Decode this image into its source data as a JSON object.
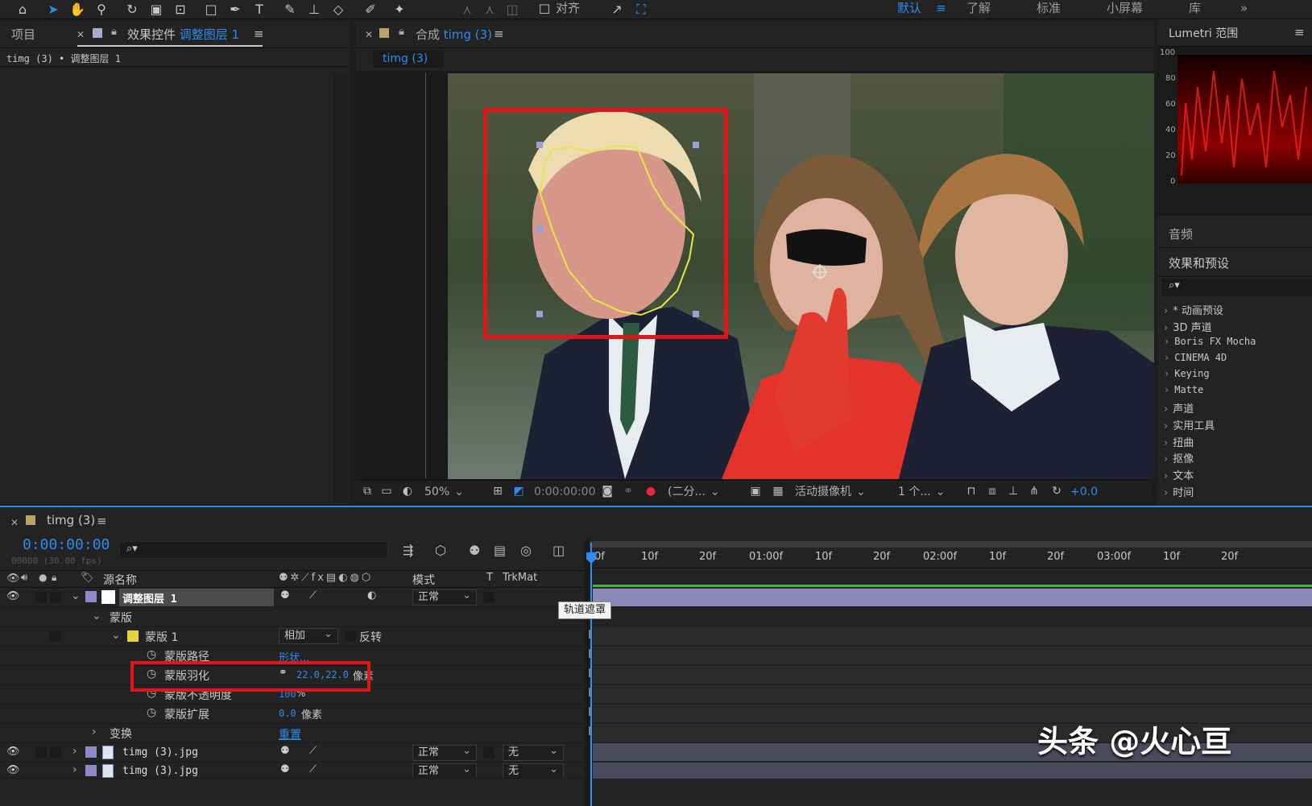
{
  "toolbar": {
    "align_label": "对齐",
    "workspaces": [
      "默认",
      "了解",
      "标准",
      "小屏幕",
      "库"
    ],
    "more": "»"
  },
  "project_panel": {
    "tab_project": "项目",
    "tab_effect_controls_prefix": "效果控件",
    "tab_effect_controls_layer": "调整图层 1",
    "breadcrumb": "timg (3) • 调整图层 1"
  },
  "comp_panel": {
    "tab_label_prefix": "合成",
    "tab_label_name": "timg (3)",
    "sub_tab": "timg (3)"
  },
  "viewer_bar": {
    "zoom": "50%",
    "timecode": "0:00:00:00",
    "resolution": "(二分...",
    "camera": "活动摄像机",
    "views": "1 个...",
    "exposure": "+0.0"
  },
  "lumetri": {
    "title": "Lumetri 范围",
    "scale": [
      "100",
      "80",
      "60",
      "40",
      "20",
      "0"
    ]
  },
  "right_panel": {
    "audio": "音频",
    "effects_title": "效果和预设",
    "search_icon": "⌕▾",
    "items": [
      "* 动画预设",
      "3D 声道",
      "Boris FX Mocha",
      "CINEMA 4D",
      "Keying",
      "Matte",
      "声道",
      "实用工具",
      "扭曲",
      "抠像",
      "文本",
      "时间"
    ]
  },
  "timeline": {
    "tab_name": "timg (3)",
    "timecode": "0:00:00:00",
    "frames": "00000 (30.00 fps)",
    "search_placeholder": "⌕▾",
    "header": {
      "source_name": "源名称",
      "mode": "模式",
      "t": "T",
      "trkmat": "TrkMat"
    },
    "tooltip": "轨道遮罩",
    "ruler": [
      "0f",
      "10f",
      "20f",
      "01:00f",
      "10f",
      "20f",
      "02:00f",
      "10f",
      "20f",
      "03:00f",
      "10f",
      "20f"
    ],
    "layers": {
      "layer1_name": "调整图层 1",
      "layer1_mode": "正常",
      "mask_group": "蒙版",
      "mask1_name": "蒙版 1",
      "mask1_mode": "相加",
      "mask1_invert": "反转",
      "mask_path_label": "蒙版路径",
      "mask_path_value": "形状...",
      "mask_feather_label": "蒙版羽化",
      "mask_feather_value": "22.0,22.0",
      "mask_feather_unit": "像素",
      "mask_opacity_label": "蒙版不透明度",
      "mask_opacity_value": "100",
      "mask_opacity_unit": "%",
      "mask_expansion_label": "蒙版扩展",
      "mask_expansion_value": "0.0",
      "mask_expansion_unit": "像素",
      "transform_label": "变换",
      "transform_value": "重置",
      "layer2_name": "timg (3).jpg",
      "layer2_mode": "正常",
      "layer2_trkmat": "无",
      "layer3_name": "timg (3).jpg",
      "layer3_mode": "正常",
      "layer3_trkmat": "无"
    }
  },
  "watermark": "头条 @火心亘",
  "colors": {
    "accent_blue": "#2d8ceb",
    "highlight_red": "#e0141b",
    "mask_yellow": "#e6e64a",
    "layer_purple": "#8b8ac6"
  }
}
